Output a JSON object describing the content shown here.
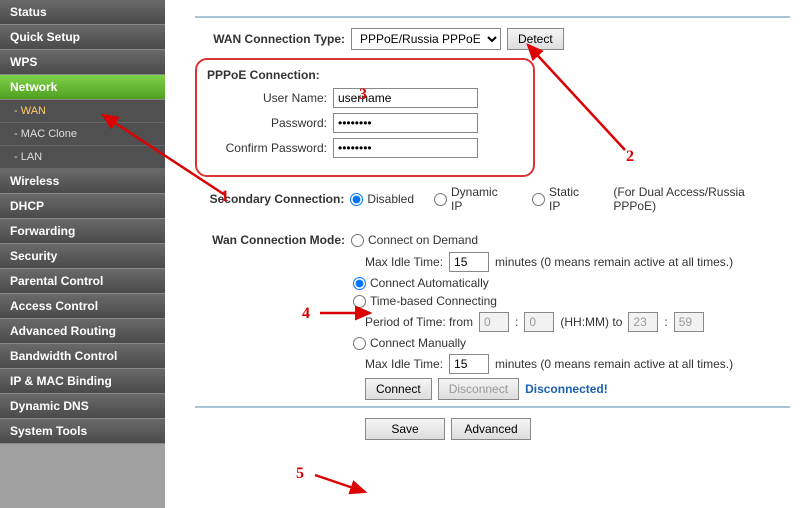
{
  "sidebar": {
    "items": [
      {
        "label": "Status",
        "type": "item"
      },
      {
        "label": "Quick Setup",
        "type": "item"
      },
      {
        "label": "WPS",
        "type": "item"
      },
      {
        "label": "Network",
        "type": "item",
        "active": true
      },
      {
        "label": "- WAN",
        "type": "sub",
        "selected": true
      },
      {
        "label": "- MAC Clone",
        "type": "sub"
      },
      {
        "label": "- LAN",
        "type": "sub"
      },
      {
        "label": "Wireless",
        "type": "item"
      },
      {
        "label": "DHCP",
        "type": "item"
      },
      {
        "label": "Forwarding",
        "type": "item"
      },
      {
        "label": "Security",
        "type": "item"
      },
      {
        "label": "Parental Control",
        "type": "item"
      },
      {
        "label": "Access Control",
        "type": "item"
      },
      {
        "label": "Advanced Routing",
        "type": "item"
      },
      {
        "label": "Bandwidth Control",
        "type": "item"
      },
      {
        "label": "IP & MAC Binding",
        "type": "item"
      },
      {
        "label": "Dynamic DNS",
        "type": "item"
      },
      {
        "label": "System Tools",
        "type": "item"
      }
    ]
  },
  "wan": {
    "conn_type_label": "WAN Connection Type:",
    "conn_type_value": "PPPoE/Russia PPPoE",
    "detect_btn": "Detect",
    "pppoe_title": "PPPoE Connection:",
    "user_label": "User Name:",
    "user_value": "username",
    "pass_label": "Password:",
    "pass_value": "********",
    "cpass_label": "Confirm Password:",
    "cpass_value": "********",
    "secondary_label": "Secondary Connection:",
    "sec_disabled": "Disabled",
    "sec_dynamic": "Dynamic IP",
    "sec_static": "Static IP",
    "sec_note": "(For Dual Access/Russia PPPoE)",
    "mode_label": "Wan Connection Mode:",
    "mode_demand": "Connect on Demand",
    "idle_label": "Max Idle Time:",
    "idle_value": "15",
    "idle_note": "minutes (0 means remain active at all times.)",
    "mode_auto": "Connect Automatically",
    "mode_time": "Time-based Connecting",
    "period_label": "Period of Time: from",
    "period_h1": "0",
    "period_m1": "0",
    "period_hhmm": "(HH:MM) to",
    "period_h2": "23",
    "period_m2": "59",
    "mode_manual": "Connect Manually",
    "connect_btn": "Connect",
    "disconnect_btn": "Disconnect",
    "status": "Disconnected!",
    "save_btn": "Save",
    "advanced_btn": "Advanced"
  },
  "annotations": {
    "a1": "1",
    "a2": "2",
    "a3": "3",
    "a4": "4",
    "a5": "5"
  }
}
